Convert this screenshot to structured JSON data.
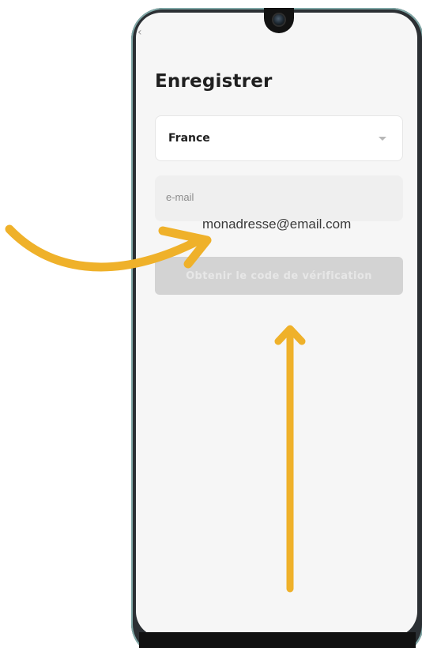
{
  "screen": {
    "title": "Enregistrer",
    "back_icon": "chevron-left-icon"
  },
  "country_select": {
    "value": "France",
    "caret_icon": "caret-down-icon"
  },
  "email_field": {
    "placeholder": "e-mail"
  },
  "annotation": {
    "email_example": "monadresse@email.com",
    "arrow_color": "#EFB12A"
  },
  "verify_button": {
    "label": "Obtenir le code de vérification",
    "state": "disabled"
  },
  "colors": {
    "screen_background": "#F6F6F6",
    "button_disabled": "#D3D3D3",
    "text_primary": "#1F1F1F"
  }
}
